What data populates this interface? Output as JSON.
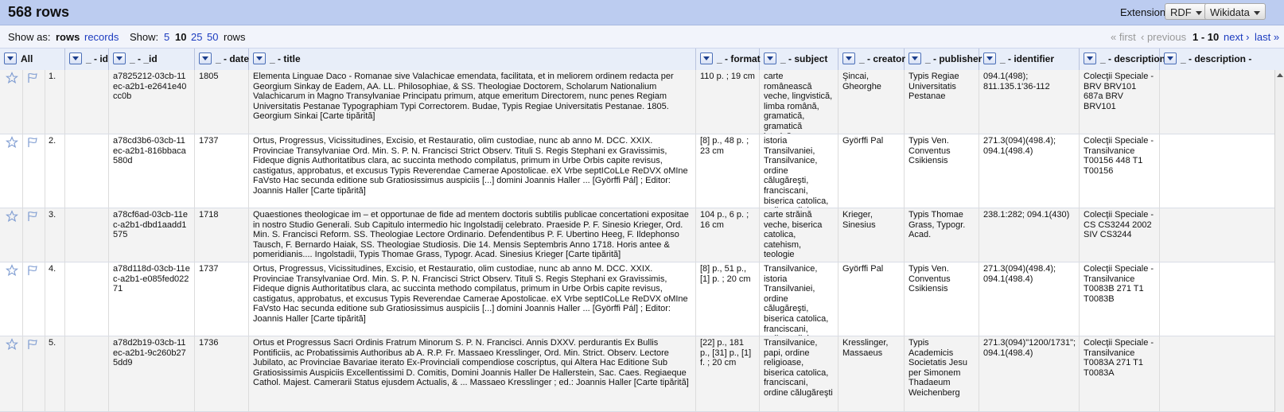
{
  "header": {
    "row_count": "568 rows",
    "extensions_label": "Extensions:",
    "extensions": [
      "RDF",
      "Wikidata"
    ]
  },
  "viewbar": {
    "show_as": "Show as:",
    "rows": "rows",
    "records": "records",
    "show": "Show:",
    "page_sizes": [
      "5",
      "10",
      "25",
      "50"
    ],
    "page_size_suffix": "rows",
    "pager": {
      "first": "« first",
      "previous": "‹ previous",
      "range": "1 - 10",
      "next": "next ›",
      "last": "last »"
    }
  },
  "columns": [
    "All",
    "_ - id",
    "_ - _id",
    "_ - date",
    "_ - title",
    "_ - format",
    "_ - subject",
    "_ - creator",
    "_ - publisher",
    "_ - identifier",
    "_ - description",
    "_ - description -"
  ],
  "rows": [
    {
      "num": "1.",
      "id": "",
      "_id": "a7825212-03cb-11ec-a2b1-e2641e40cc0b",
      "date": "1805",
      "title": "Elementa Linguae Daco - Romanae sive Valachicae emendata, facilitata, et in meliorem ordinem redacta per Georgium Sinkay de Eadem, AA. LL. Philosophiae, & SS. Theologiae Doctorem, Scholarum Nationalium Valachicarum in Magno Transylvaniae Principatu primum, atque emeritum Directorem, nunc penes Regiam Universitatis Pestanae Typographiam Typi Correctorem. Budae, Typis Regiae Universitatis Pestanae. 1805. Georgium Sinkai [Carte tipărită]",
      "format": "110 p. ; 19 cm",
      "subject": "carte românească veche, lingvistică, limba română, gramatică, gramatică istorică, morfologie",
      "creator": "Şincai, Gheorghe",
      "publisher": "Typis Regiae Universitatis Pestanae",
      "identifier": "094.1(498); 811.135.1'36-112",
      "description": "Colecţii Speciale - BRV BRV101 687a BRV BRV101"
    },
    {
      "num": "2.",
      "id": "",
      "_id": "a78cd3b6-03cb-11ec-a2b1-816bbaca580d",
      "date": "1737",
      "title": "Ortus, Progressus, Vicissitudines, Excisio, et Restauratio, olim custodiae, nunc ab anno M. DCC. XXIX. Provinciae Transylvaniae Ord. Min. S. P. N. Francisci Strict Observ. Tituli S. Regis Stephani ex Gravissimis, Fideque dignis Authoritatibus clara, ac succinta methodo compilatus, primum in Urbe Orbis capite revisus, castigatus, approbatus, et excusus Typis Reverendae Camerae Apostolicae. eX Vrbe septICoLLe ReDVX oMIne FaVsto Hac secunda editione sub Gratiosissimus auspiciis [...] domini Joannis Haller ... [Györffi Pál] ; Editor: Joannis Haller [Carte tipărită]",
      "format": "[8] p., 48 p. ; 23 cm",
      "subject": "istoria Transilvaniei, Transilvanice, ordine călugăreşti, franciscani, biserica catolica, ordine religioase",
      "creator": "Györffi Pal",
      "publisher": "Typis Ven. Conventus Csikiensis",
      "identifier": "271.3(094)(498.4); 094.1(498.4)",
      "description": "Colecţii Speciale - Transilvanice T00156 448 T1 T00156"
    },
    {
      "num": "3.",
      "id": "",
      "_id": "a78cf6ad-03cb-11ec-a2b1-dbd1aadd1575",
      "date": "1718",
      "title": "Quaestiones theologicae im – et opportunae de fide ad mentem doctoris subtilis publicae concertationi expositae in nostro Studio Generali. Sub Capitulo intermedio hic Ingolstadij celebrato. Praeside P. F. Sinesio Krieger, Ord. Min. S. Francisci Reform. SS. Theologiae Lectore Ordinario. Defendentibus P. F. Ubertino Heeg, F. Ildephonso Tausch, F. Bernardo Haiak, SS. Theologiae Studiosis. Die 14. Mensis Septembris Anno 1718. Horis antee & pomeridianis.... Ingolstadii, Typis Thomae Grass, Typogr. Acad. Sinesius Krieger [Carte tipărită]",
      "format": "104 p., 6 p. ; 16 cm",
      "subject": "carte străină veche, biserica catolica, catehism, teologie",
      "creator": "Krieger, Sinesius",
      "publisher": "Typis Thomae Grass, Typogr. Acad.",
      "identifier": "238.1:282; 094.1(430)",
      "description": "Colecţii Speciale - CS CS3244 2002 SIV CS3244"
    },
    {
      "num": "4.",
      "id": "",
      "_id": "a78d118d-03cb-11ec-a2b1-e085fed02271",
      "date": "1737",
      "title": "Ortus, Progressus, Vicissitudines, Excisio, et Restauratio, olim custodiae, nunc ab anno M. DCC. XXIX. Provinciae Transylvaniae Ord. Min. S. P. N. Francisci Strict Observ. Tituli S. Regis Stephani ex Gravissimis, Fideque dignis Authoritatibus clara, ac succinta methodo compilatus, primum in Urbe Orbis capite revisus, castigatus, approbatus, et excusus Typis Reverendae Camerae Apostolicae. eX Vrbe septICoLLe ReDVX oMIne FaVsto Hac secunda editione sub Gratiosissimus auspiciis [...] domini Joannis Haller ... [Györffi Pál] ; Editor: Joannis Haller [Carte tipărită]",
      "format": "[8] p., 51 p., [1] p. ; 20 cm",
      "subject": "Transilvanice, istoria Transilvaniei, ordine călugăreşti, biserica catolica, franciscani, ordine religioase",
      "creator": "Györffi Pal",
      "publisher": "Typis Ven. Conventus Csikiensis",
      "identifier": "271.3(094)(498.4); 094.1(498.4)",
      "description": "Colecţii Speciale - Transilvanice T0083B 271 T1 T0083B"
    },
    {
      "num": "5.",
      "id": "",
      "_id": "a78d2b19-03cb-11ec-a2b1-9c260b275dd9",
      "date": "1736",
      "title": "Ortus et Progressus Sacri Ordinis Fratrum Minorum S. P. N. Francisci. Annis DXXV. perdurantis Ex Bullis Pontificiis, ac Probatissimis Authoribus ab A. R.P. Fr. Massaeo Kresslinger, Ord. Min. Strict. Observ. Lectore Jubilato, ac Provinciae Bavariae iterato Ex-Provinciali compendiose coscriptus, qui Altera Hac Editione Sub Gratiosissimis Auspiciis Excellentissimi D. Comitis, Domini Joannis Haller De Hallerstein, Sac. Caes. Regiaeque Cathol. Majest. Camerarii Status ejusdem Actualis, & ... Massaeo Kresslinger ; ed.: Joannis Haller [Carte tipărită]",
      "format": "[22] p., 181 p., [31] p., [1] f. ; 20 cm",
      "subject": "Transilvanice, papi, ordine religioase, biserica catolica, franciscani, ordine călugăreşti",
      "creator": "Kresslinger, Massaeus",
      "publisher": "Typis Academicis Societatis Jesu per Simonem Thadaeum Weichenberg",
      "identifier": "271.3(094)\"1200/1731\"; 094.1(498.4)",
      "description": "Colecţii Speciale - Transilvanice T0083A 271 T1 T0083A"
    }
  ],
  "colors": {
    "header_bg": "#bcccf0",
    "link": "#1b3bbf",
    "odd_row": "#f3f3f3"
  }
}
